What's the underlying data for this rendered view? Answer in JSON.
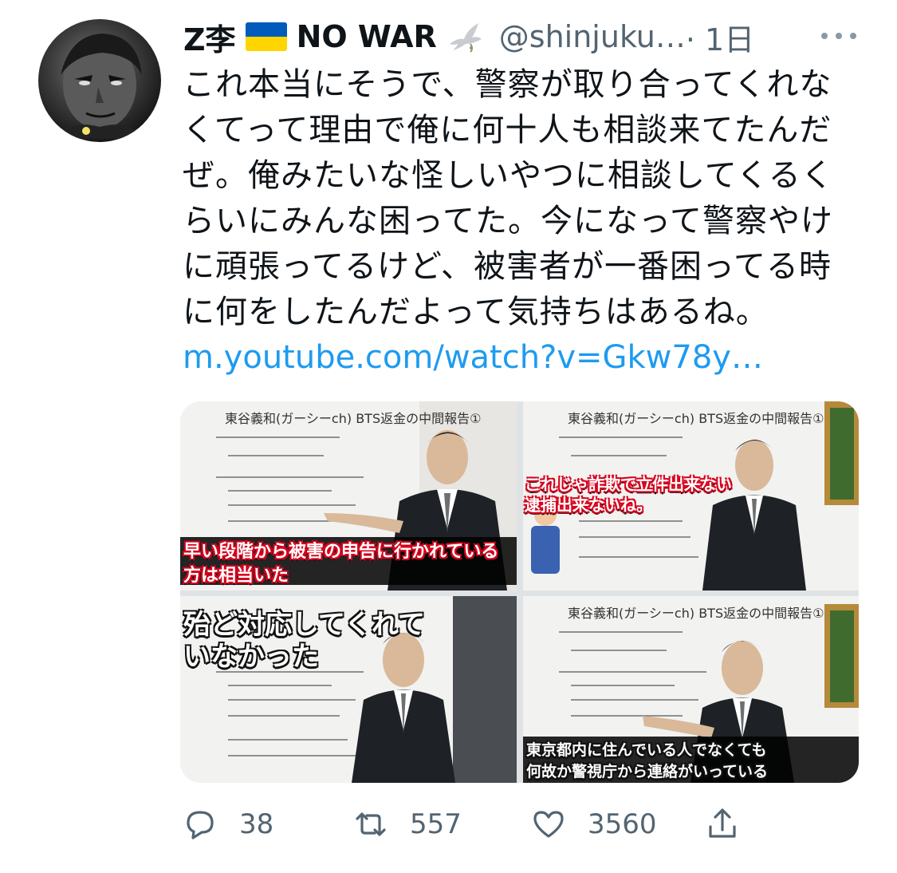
{
  "author": {
    "display_name": "Z李",
    "slogan": "NO WAR",
    "handle": "@shinjuku…",
    "time": "· 1日",
    "flag_icon": "ukraine-flag-icon",
    "dove_icon": "dove-icon"
  },
  "tweet": {
    "lines": [
      "これ本当にそうで、警察が取り合ってくれな",
      "くてって理由で俺に何十人も相談来てたんだ",
      "ぜ。俺みたいな怪しいやつに相談してくるく",
      "らいにみんな困ってた。今になって警察やけ",
      "に頑張ってるけど、被害者が一番困ってる時",
      "に何をしたんだよって気持ちはあるね。"
    ],
    "link": "m.youtube.com/watch?v=Gkw78y…"
  },
  "media": {
    "board_title": "東谷義和(ガーシーch) BTS返金の中間報告①",
    "images": [
      {
        "caption_lines": [
          "早い段階から被害の申告に行かれている",
          "方は相当いた"
        ]
      },
      {
        "caption_lines": [
          "これじゃ詐欺で立件出来ない",
          "逮捕出来ないね。"
        ]
      },
      {
        "caption_lines": [
          "殆ど対応してくれて",
          "いなかった"
        ]
      },
      {
        "caption_lines": [
          "東京都内に住んでいる人でなくても",
          "何故か警視庁から連絡がいっている"
        ]
      }
    ]
  },
  "actions": {
    "replies": "38",
    "retweets": "557",
    "likes": "3560"
  },
  "colors": {
    "text": "#0f1419",
    "secondary": "#536471",
    "link": "#1d9bf0",
    "flag_blue": "#005bbb",
    "flag_yellow": "#ffd500"
  }
}
